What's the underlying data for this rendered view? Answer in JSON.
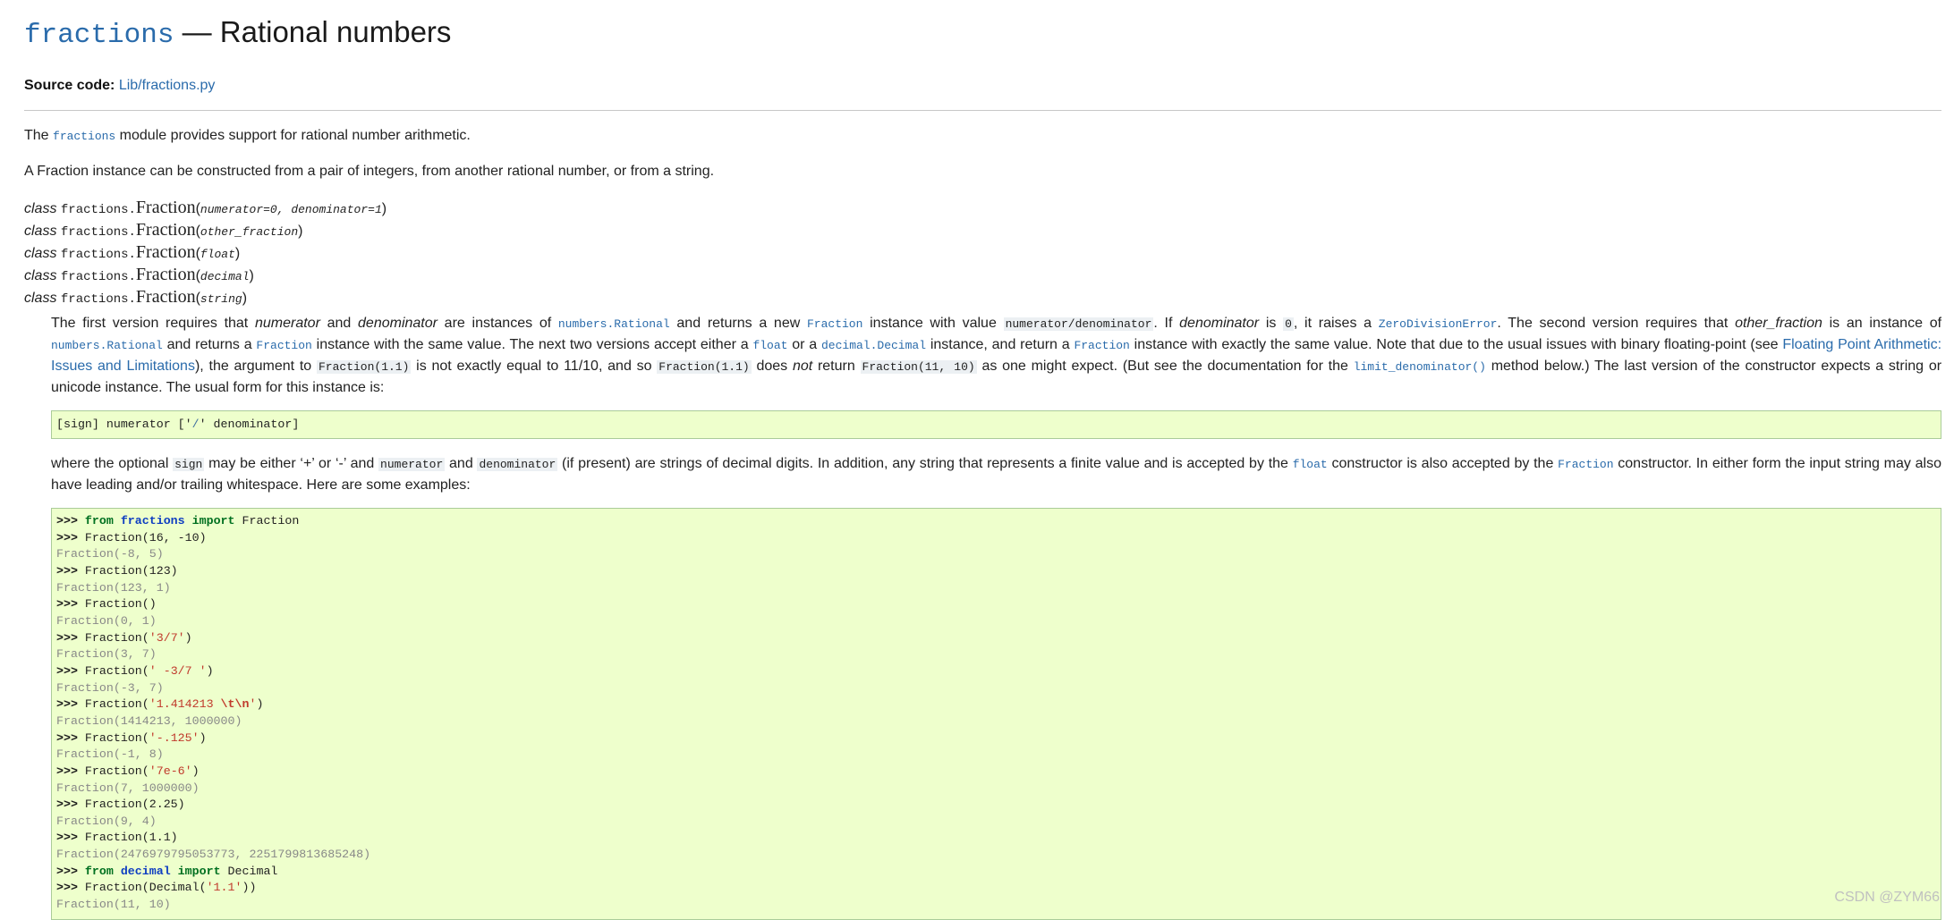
{
  "title": {
    "module": "fractions",
    "rest": " — Rational numbers"
  },
  "source": {
    "label": "Source code:",
    "link": "Lib/fractions.py"
  },
  "intro": {
    "p1_pre": "The ",
    "p1_code": "fractions",
    "p1_post": " module provides support for rational number arithmetic.",
    "p2": "A Fraction instance can be constructed from a pair of integers, from another rational number, or from a string."
  },
  "signatures": [
    {
      "kw": "class",
      "prefix": "fractions.",
      "name": "Fraction",
      "params": "numerator=0, denominator=1"
    },
    {
      "kw": "class",
      "prefix": "fractions.",
      "name": "Fraction",
      "params": "other_fraction"
    },
    {
      "kw": "class",
      "prefix": "fractions.",
      "name": "Fraction",
      "params": "float"
    },
    {
      "kw": "class",
      "prefix": "fractions.",
      "name": "Fraction",
      "params": "decimal"
    },
    {
      "kw": "class",
      "prefix": "fractions.",
      "name": "Fraction",
      "params": "string"
    }
  ],
  "desc": {
    "t1": "The first version requires that ",
    "i1": "numerator",
    "t2": " and ",
    "i2": "denominator",
    "t3": " are instances of ",
    "c1": "numbers.Rational",
    "t4": " and returns a new ",
    "c2": "Fraction",
    "t5": " instance with value ",
    "c3": "numerator/denominator",
    "t6": ". If ",
    "i3": "denominator",
    "t7": " is ",
    "c4": "0",
    "t8": ", it raises a ",
    "c5": "ZeroDivisionError",
    "t9": ". The second version requires that ",
    "i4": "other_fraction",
    "t10": " is an instance of ",
    "c6": "numbers.Rational",
    "t11": " and returns a ",
    "c7": "Fraction",
    "t12": " instance with the same value. The next two versions accept either a ",
    "c8": "float",
    "t13": " or a ",
    "c9": "decimal.Decimal",
    "t14": " instance, and return a ",
    "c10": "Fraction",
    "t15": " instance with exactly the same value. Note that due to the usual issues with binary floating-point (see ",
    "l1": "Floating Point Arithmetic: Issues and Limitations",
    "t16": "), the argument to ",
    "c11": "Fraction(1.1)",
    "t17": " is not exactly equal to 11/10, and so ",
    "c12": "Fraction(1.1)",
    "t18": " does ",
    "i5": "not",
    "t19": " return ",
    "c13": "Fraction(11, 10)",
    "t20": " as one might expect. (But see the documentation for the ",
    "c14": "limit_denominator()",
    "t21": " method below.) The last version of the constructor expects a string or unicode instance. The usual form for this instance is:"
  },
  "grammar": {
    "a": "[sign] numerator ['",
    "b": "/",
    "c": "' denominator]"
  },
  "after": {
    "t1": "where the optional ",
    "c1": "sign",
    "t2": " may be either ‘+’ or ‘-’ and ",
    "c2": "numerator",
    "t3": " and ",
    "c3": "denominator",
    "t4": " (if present) are strings of decimal digits. In addition, any string that represents a finite value and is accepted by the ",
    "c4": "float",
    "t5": " constructor is also accepted by the ",
    "c5": "Fraction",
    "t6": " constructor. In either form the input string may also have leading and/or trailing whitespace. Here are some examples:"
  },
  "examples": {
    "prompt": ">>> ",
    "from": "from",
    "import": "import",
    "l1_mod": "fractions",
    "l1_name": "Fraction",
    "l2": "Fraction(16, -10)",
    "o2": "Fraction(-8, 5)",
    "l3": "Fraction(123)",
    "o3": "Fraction(123, 1)",
    "l4": "Fraction()",
    "o4": "Fraction(0, 1)",
    "l5_pre": "Fraction(",
    "l5_str": "'3/7'",
    "l5_post": ")",
    "o5": "Fraction(3, 7)",
    "l6_pre": "Fraction(",
    "l6_str": "' -3/7 '",
    "l6_post": ")",
    "o6": "Fraction(-3, 7)",
    "l7_pre": "Fraction(",
    "l7_str": "'1.414213 ",
    "l7_esc": "\\t\\n",
    "l7_str2": "'",
    "l7_post": ")",
    "o7": "Fraction(1414213, 1000000)",
    "l8_pre": "Fraction(",
    "l8_str": "'-.125'",
    "l8_post": ")",
    "o8": "Fraction(-1, 8)",
    "l9_pre": "Fraction(",
    "l9_str": "'7e-6'",
    "l9_post": ")",
    "o9": "Fraction(7, 1000000)",
    "l10": "Fraction(2.25)",
    "o10": "Fraction(9, 4)",
    "l11": "Fraction(1.1)",
    "o11": "Fraction(2476979795053773, 2251799813685248)",
    "l12_mod": "decimal",
    "l12_name": "Decimal",
    "l13_pre": "Fraction(Decimal(",
    "l13_str": "'1.1'",
    "l13_post": "))",
    "o13": "Fraction(11, 10)"
  },
  "watermark": "CSDN @ZYM66"
}
